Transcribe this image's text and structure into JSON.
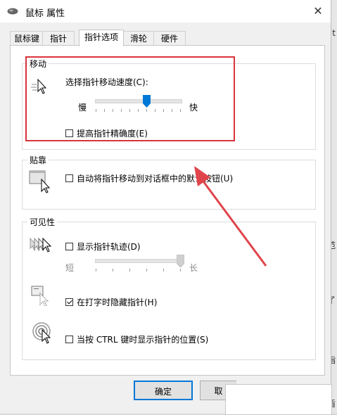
{
  "window": {
    "title": "鼠标 属性",
    "close_glyph": "✕"
  },
  "tabs": [
    {
      "label": "鼠标键"
    },
    {
      "label": "指针"
    },
    {
      "label": "指针选项",
      "active": true
    },
    {
      "label": "滑轮"
    },
    {
      "label": "硬件"
    }
  ],
  "motion": {
    "legend": "移动",
    "speed_label": "选择指针移动速度(C):",
    "slow": "慢",
    "fast": "快",
    "speed_level": 0.6,
    "precision_label": "提高指针精确度(E)",
    "precision_checked": false
  },
  "snap": {
    "legend": "贴靠",
    "snap_label": "自动将指针移动到对话框中的默认按钮(U)",
    "snap_checked": false
  },
  "visibility": {
    "legend": "可见性",
    "trails_label": "显示指针轨迹(D)",
    "trails_checked": false,
    "short": "短",
    "long": "长",
    "trail_level": 1.0,
    "hide_label": "在打字时隐藏指针(H)",
    "hide_checked": true,
    "ctrl_label": "当按 CTRL 键时显示指针的位置(S)",
    "ctrl_checked": false
  },
  "buttons": {
    "ok": "确定",
    "cancel": "取"
  },
  "background_glyphs": [
    "t",
    "范",
    "了",
    "指",
    "盾"
  ],
  "colors": {
    "highlight": "#d9343b",
    "arrow": "#e0444b",
    "slider_thumb": "#0078d7"
  }
}
